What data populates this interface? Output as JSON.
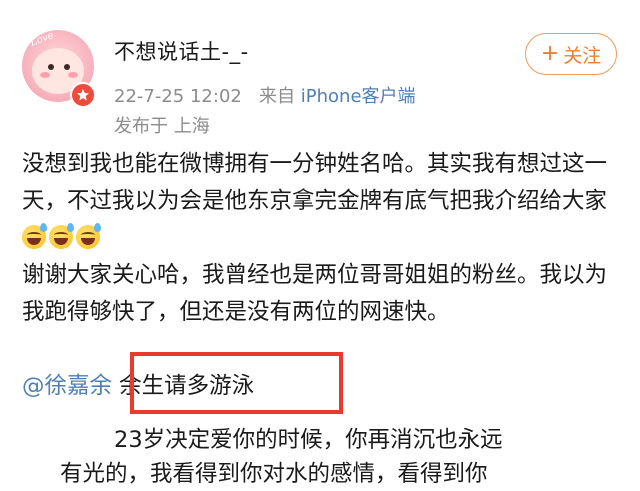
{
  "post": {
    "username": "不想说话土-_-",
    "date": "22-7-25 12:02",
    "source_prefix": "来自",
    "source": "iPhone客户端",
    "location": "发布于 上海",
    "follow_label": "关注",
    "avatar_text": "Love",
    "body": {
      "p1": "没想到我也能在微博拥有一分钟姓名哈。其实我有想过这一天，不过我以为会是他东京拿完金牌有底气把我介绍给大家",
      "p2": "谢谢大家关心哈，我曾经也是两位哥哥姐姐的粉丝。我以为我跑得够快了，但还是没有两位的网速快。"
    },
    "mention": "@徐嘉余",
    "mention_text": "余生请多游泳",
    "quote": {
      "line1": "23岁决定爱你的时候，你再消沉也永远",
      "line2": "有光的，我看得到你对水的感情，看得到你"
    }
  },
  "colors": {
    "link": "#4e7fb8",
    "follow": "#ef7d2e",
    "highlight": "#ea3a2e",
    "meta": "#8c8c8c"
  }
}
